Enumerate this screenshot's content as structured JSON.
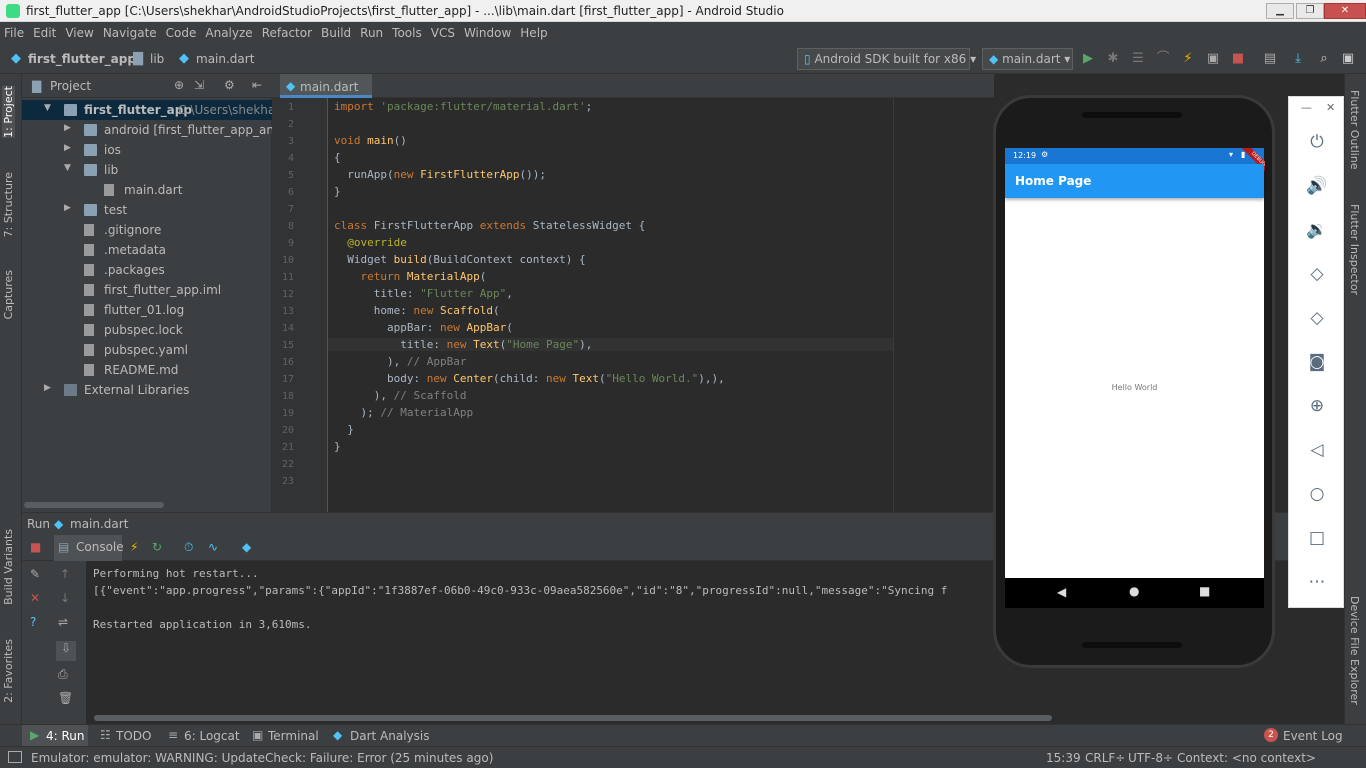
{
  "window": {
    "title": "first_flutter_app [C:\\Users\\shekhar\\AndroidStudioProjects\\first_flutter_app] - ...\\lib\\main.dart [first_flutter_app] - Android Studio",
    "min": "▁",
    "max": "❐",
    "close": "✕"
  },
  "menu": [
    "File",
    "Edit",
    "View",
    "Navigate",
    "Code",
    "Analyze",
    "Refactor",
    "Build",
    "Run",
    "Tools",
    "VCS",
    "Window",
    "Help"
  ],
  "breadcrumb": {
    "project": "first_flutter_app",
    "folder": "lib",
    "file": "main.dart"
  },
  "toolbar": {
    "device": "Android SDK built for x86",
    "config": "main.dart"
  },
  "left_tabs": {
    "project": "1: Project",
    "structure": "7: Structure",
    "captures": "Captures",
    "build_variants": "Build Variants",
    "favorites": "2: Favorites"
  },
  "right_tabs": {
    "outline": "Flutter Outline",
    "inspector": "Flutter Inspector",
    "device_explorer": "Device File Explorer"
  },
  "project_panel": {
    "title": "Project",
    "tree": [
      {
        "label": "first_flutter_app",
        "extra": "C:\\Users\\shekhar\\Anc",
        "type": "folder",
        "indent": 0,
        "expanded": true,
        "selected": true
      },
      {
        "label": "android [first_flutter_app_android]",
        "type": "folder",
        "indent": 1,
        "expanded": false
      },
      {
        "label": "ios",
        "type": "folder",
        "indent": 1,
        "expanded": false
      },
      {
        "label": "lib",
        "type": "folder",
        "indent": 1,
        "expanded": true
      },
      {
        "label": "main.dart",
        "type": "file",
        "indent": 2
      },
      {
        "label": "test",
        "type": "folder",
        "indent": 1,
        "expanded": false
      },
      {
        "label": ".gitignore",
        "type": "file",
        "indent": 1
      },
      {
        "label": ".metadata",
        "type": "file",
        "indent": 1
      },
      {
        "label": ".packages",
        "type": "file",
        "indent": 1
      },
      {
        "label": "first_flutter_app.iml",
        "type": "file",
        "indent": 1
      },
      {
        "label": "flutter_01.log",
        "type": "file",
        "indent": 1
      },
      {
        "label": "pubspec.lock",
        "type": "file",
        "indent": 1
      },
      {
        "label": "pubspec.yaml",
        "type": "file",
        "indent": 1
      },
      {
        "label": "README.md",
        "type": "file",
        "indent": 1
      },
      {
        "label": "External Libraries",
        "type": "lib",
        "indent": 0,
        "expanded": false
      }
    ]
  },
  "editor": {
    "tab": "main.dart",
    "lines": [
      [
        [
          "kw",
          "import "
        ],
        [
          "str",
          "'package:flutter/material.dart'"
        ],
        [
          "",
          "; "
        ]
      ],
      [],
      [
        [
          "kw",
          "void "
        ],
        [
          "fn",
          "main"
        ],
        [
          "",
          "()"
        ]
      ],
      [
        [
          "",
          "{"
        ]
      ],
      [
        [
          "",
          "  runApp("
        ],
        [
          "kw",
          "new "
        ],
        [
          "fn",
          "FirstFlutterApp"
        ],
        [
          "",
          "());"
        ]
      ],
      [
        [
          "",
          "}"
        ]
      ],
      [],
      [
        [
          "kw",
          "class "
        ],
        [
          "",
          "FirstFlutterApp "
        ],
        [
          "kw",
          "extends "
        ],
        [
          "",
          "StatelessWidget {"
        ]
      ],
      [
        [
          "an",
          "  @override"
        ]
      ],
      [
        [
          "",
          "  Widget "
        ],
        [
          "fn",
          "build"
        ],
        [
          "",
          "(BuildContext context) {"
        ]
      ],
      [
        [
          "kw",
          "    return "
        ],
        [
          "fn",
          "MaterialApp"
        ],
        [
          "",
          "("
        ]
      ],
      [
        [
          "",
          "      title: "
        ],
        [
          "str",
          "\"Flutter App\""
        ],
        [
          "",
          ","
        ]
      ],
      [
        [
          "",
          "      home: "
        ],
        [
          "kw",
          "new "
        ],
        [
          "fn",
          "Scaffold"
        ],
        [
          "",
          "("
        ]
      ],
      [
        [
          "",
          "        appBar: "
        ],
        [
          "kw",
          "new "
        ],
        [
          "fn",
          "AppBar"
        ],
        [
          "",
          "("
        ]
      ],
      [
        [
          "",
          "          title: "
        ],
        [
          "kw",
          "new "
        ],
        [
          "fn",
          "Text"
        ],
        [
          "",
          "("
        ],
        [
          "str",
          "\"Home Page\""
        ],
        [
          "",
          "),"
        ]
      ],
      [
        [
          "",
          "        ), "
        ],
        [
          "cm",
          "// AppBar"
        ]
      ],
      [
        [
          "",
          "        body: "
        ],
        [
          "kw",
          "new "
        ],
        [
          "fn",
          "Center"
        ],
        [
          "",
          "(child: "
        ],
        [
          "kw",
          "new "
        ],
        [
          "fn",
          "Text"
        ],
        [
          "",
          "("
        ],
        [
          "str",
          "\"Hello World.\""
        ],
        [
          "",
          "),),"
        ]
      ],
      [
        [
          "",
          "      ), "
        ],
        [
          "cm",
          "// Scaffold"
        ]
      ],
      [
        [
          "",
          "    ); "
        ],
        [
          "cm",
          "// MaterialApp"
        ]
      ],
      [
        [
          "",
          "  }"
        ]
      ],
      [
        [
          "",
          "}"
        ]
      ],
      [],
      []
    ]
  },
  "run": {
    "header_label": "Run",
    "header_file": "main.dart",
    "console_tab": "Console",
    "output": [
      "Performing hot restart...",
      "[{\"event\":\"app.progress\",\"params\":{\"appId\":\"1f3887ef-06b0-49c0-933c-09aea582560e\",\"id\":\"8\",\"progressId\":null,\"message\":\"Syncing f",
      "",
      "Restarted application in 3,610ms."
    ]
  },
  "bottom_tabs": [
    "4: Run",
    "TODO",
    "6: Logcat",
    "Terminal",
    "Dart Analysis"
  ],
  "event_log": {
    "count": "2",
    "label": "Event Log"
  },
  "status": {
    "message": "Emulator: emulator: WARNING: UpdateCheck: Failure: Error (25 minutes ago)",
    "position": "15:39",
    "line_sep": "CRLF÷",
    "encoding": "UTF-8÷",
    "context": "Context: <no context>"
  },
  "phone": {
    "time": "12:19",
    "appbar_title": "Home Page",
    "body_text": "Hello World",
    "debug_banner": "DEBUG"
  },
  "emulator_tools": [
    "power-icon",
    "volume-up-icon",
    "volume-down-icon",
    "rotate-left-icon",
    "rotate-right-icon",
    "camera-icon",
    "zoom-icon",
    "back-icon",
    "home-icon",
    "overview-icon",
    "more-icon"
  ],
  "colors": {
    "accent": "#4a88c7",
    "appbar": "#2196f3",
    "statusbar": "#1976d2"
  }
}
